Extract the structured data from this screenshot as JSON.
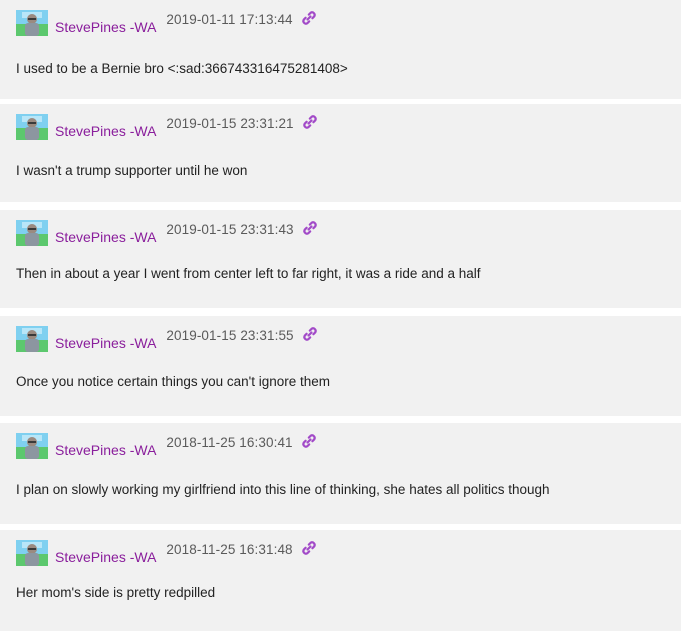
{
  "messages": [
    {
      "author": "StevePines -WA",
      "timestamp": "2019-01-11 17:13:44",
      "text": "I used to be a Bernie bro <:sad:366743316475281408>",
      "link_icon": "link-icon"
    },
    {
      "author": "StevePines -WA",
      "timestamp": "2019-01-15 23:31:21",
      "text": "I wasn't a trump supporter until he won",
      "link_icon": "link-icon"
    },
    {
      "author": "StevePines -WA",
      "timestamp": "2019-01-15 23:31:43",
      "text": "Then in about a year I went from center left to far right, it was a ride and a half",
      "link_icon": "link-icon"
    },
    {
      "author": "StevePines -WA",
      "timestamp": "2019-01-15 23:31:55",
      "text": "Once you notice certain things you can't ignore them",
      "link_icon": "link-icon"
    },
    {
      "author": "StevePines -WA",
      "timestamp": "2018-11-25 16:30:41",
      "text": "I plan on slowly working my girlfriend into this line of thinking, she hates all politics though",
      "link_icon": "link-icon"
    },
    {
      "author": "StevePines -WA",
      "timestamp": "2018-11-25 16:31:48",
      "text": "Her mom's side is pretty redpilled",
      "link_icon": "link-icon"
    }
  ],
  "colors": {
    "author": "#8a1e9c",
    "timestamp": "#5a5a5a",
    "text": "#222222",
    "message_bg": "#f1f1f1",
    "link_icon": "#a24ac8"
  }
}
